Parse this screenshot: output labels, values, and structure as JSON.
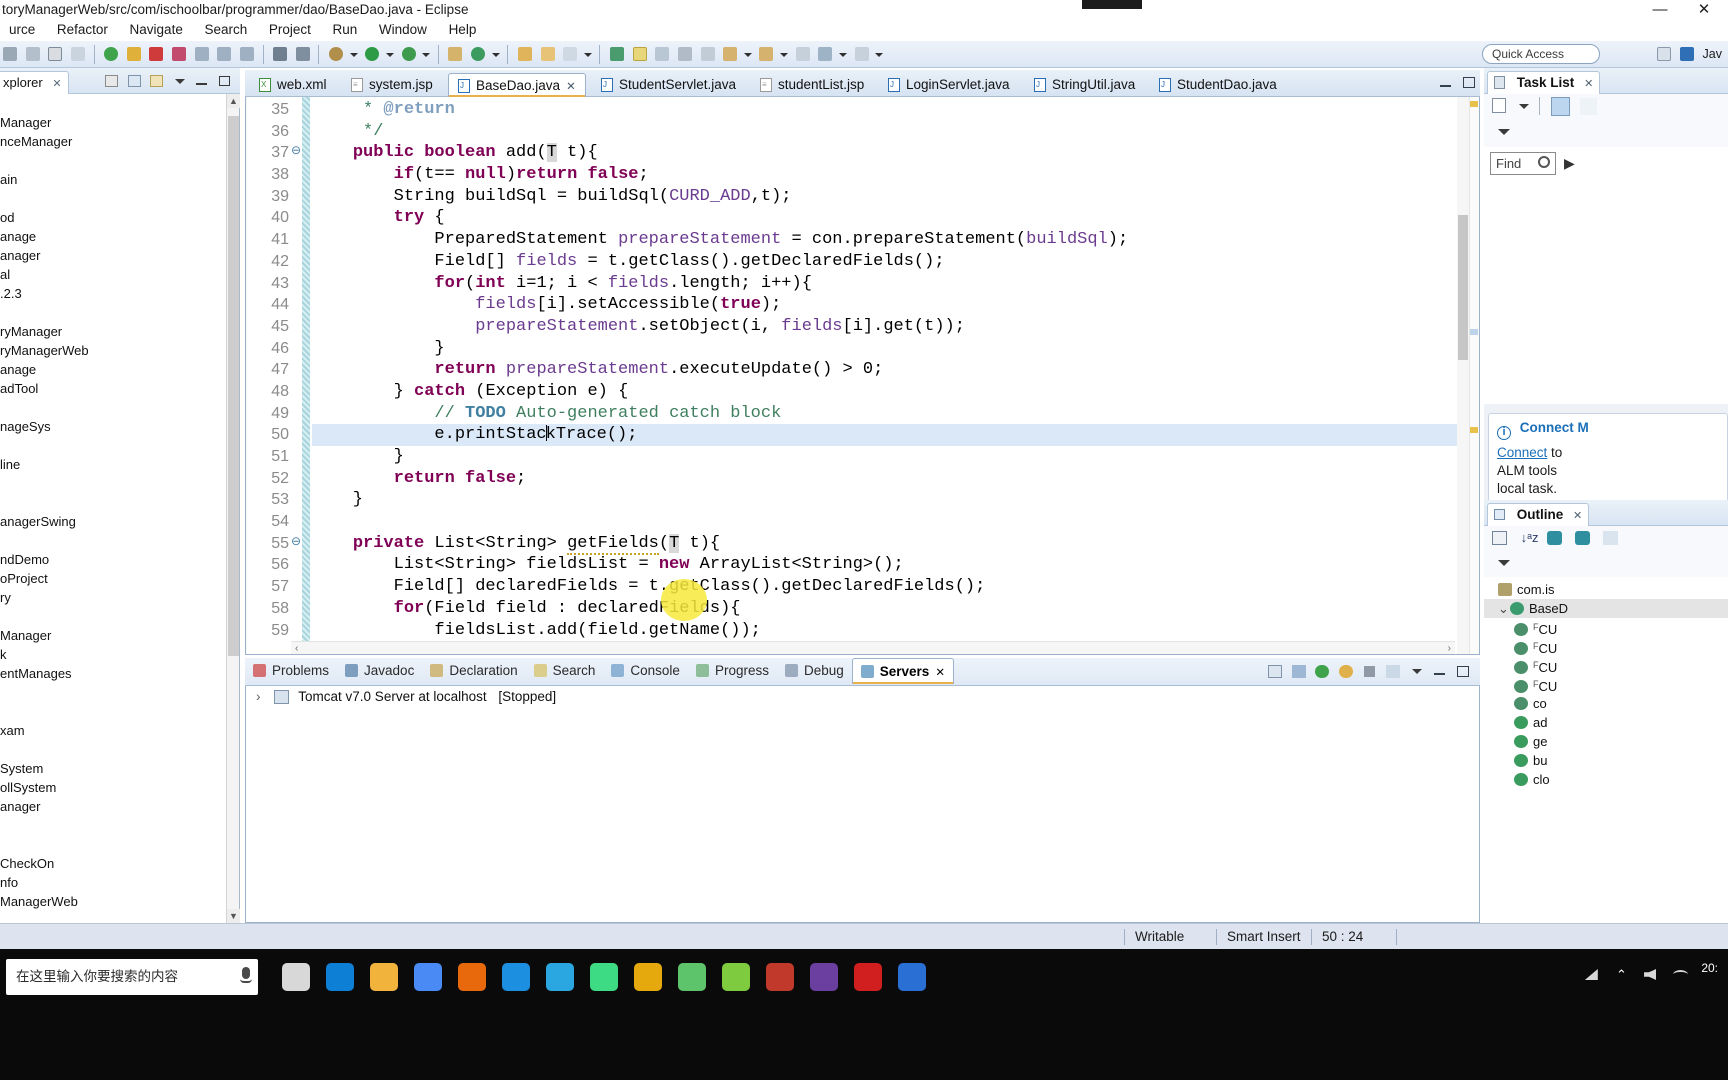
{
  "window": {
    "title": "toryManagerWeb/src/com/ischoolbar/programmer/dao/BaseDao.java - Eclipse",
    "minimize_label": "—",
    "close_label": "✕"
  },
  "menubar": {
    "items": [
      "urce",
      "Refactor",
      "Navigate",
      "Search",
      "Project",
      "Run",
      "Window",
      "Help"
    ]
  },
  "toolbar": {
    "quick_access_placeholder": "Quick Access",
    "perspective_label": "Jav"
  },
  "explorer": {
    "tab_label": "xplorer",
    "close_label": "✕",
    "tree": [
      "",
      "Manager",
      "nceManager",
      "",
      "ain",
      "",
      "od",
      "anage",
      "anager",
      "al",
      ".2.3",
      "",
      "ryManager",
      "ryManagerWeb",
      "anage",
      "adTool",
      "",
      "nageSys",
      "",
      "line",
      "",
      "",
      "anagerSwing",
      "",
      "ndDemo",
      "oProject",
      "ry",
      "",
      "Manager",
      "k",
      "entManages",
      "",
      "",
      "xam",
      "",
      "System",
      "ollSystem",
      "anager",
      "",
      "",
      "CheckOn",
      "nfo",
      "ManagerWeb"
    ]
  },
  "editor": {
    "tabs": [
      {
        "label": "web.xml",
        "icon": "xml-file-icon",
        "active": false,
        "icon_color": "#3b8f3b"
      },
      {
        "label": "system.jsp",
        "icon": "jsp-file-icon",
        "active": false,
        "icon_color": "#9a9a9a"
      },
      {
        "label": "BaseDao.java",
        "icon": "java-file-icon",
        "active": true,
        "icon_color": "#2a6fb5"
      },
      {
        "label": "StudentServlet.java",
        "icon": "java-file-icon",
        "active": false,
        "icon_color": "#2a6fb5"
      },
      {
        "label": "studentList.jsp",
        "icon": "jsp-file-icon",
        "active": false,
        "icon_color": "#9a9a9a"
      },
      {
        "label": "LoginServlet.java",
        "icon": "java-file-icon",
        "active": false,
        "icon_color": "#2a6fb5"
      },
      {
        "label": "StringUtil.java",
        "icon": "java-file-icon",
        "active": false,
        "icon_color": "#2a6fb5"
      },
      {
        "label": "StudentDao.java",
        "icon": "java-file-icon",
        "active": false,
        "icon_color": "#2a6fb5"
      }
    ],
    "active_tab_close": "✕",
    "lines": [
      {
        "no": "35",
        "fold": "",
        "marker": "",
        "html": "     <span class='cm'>* </span><span class='tag'>@return</span>"
      },
      {
        "no": "36",
        "fold": "",
        "marker": "",
        "html": "     <span class='cm'>*/</span>"
      },
      {
        "no": "37",
        "fold": "⊖",
        "marker": "",
        "html": "    <span class='kw'>public boolean</span> add(<span class='tparam'>T</span> t){"
      },
      {
        "no": "38",
        "fold": "",
        "marker": "",
        "html": "        <span class='kw'>if</span>(t== <span class='kw'>null</span>)<span class='kw'>return false</span>;"
      },
      {
        "no": "39",
        "fold": "",
        "marker": "",
        "html": "        String buildSql = buildSql(<span class='cst'>CURD_ADD</span>,t);"
      },
      {
        "no": "40",
        "fold": "",
        "marker": "",
        "html": "        <span class='kw'>try</span> {"
      },
      {
        "no": "41",
        "fold": "",
        "marker": "",
        "html": "            PreparedStatement <span class='cst'>prepareStatement</span> = con.prepareStatement(<span class='cst'>buildSql</span>);"
      },
      {
        "no": "42",
        "fold": "",
        "marker": "",
        "html": "            Field[] <span class='cst'>fields</span> = t.getClass().getDeclaredFields();"
      },
      {
        "no": "43",
        "fold": "",
        "marker": "",
        "html": "            <span class='kw'>for</span>(<span class='kw'>int</span> i=1; i &lt; <span class='cst'>fields</span>.length; i++){"
      },
      {
        "no": "44",
        "fold": "",
        "marker": "",
        "html": "                <span class='cst'>fields</span>[i].setAccessible(<span class='kw'>true</span>);"
      },
      {
        "no": "45",
        "fold": "",
        "marker": "",
        "html": "                <span class='cst'>prepareStatement</span>.setObject(i, <span class='cst'>fields</span>[i].get(t));"
      },
      {
        "no": "46",
        "fold": "",
        "marker": "",
        "html": "            }"
      },
      {
        "no": "47",
        "fold": "",
        "marker": "",
        "html": "            <span class='kw'>return</span> <span class='cst'>prepareStatement</span>.executeUpdate() &gt; 0;"
      },
      {
        "no": "48",
        "fold": "",
        "marker": "",
        "html": "        } <span class='kw'>catch</span> (Exception e) {"
      },
      {
        "no": "49",
        "fold": "",
        "marker": "todo",
        "html": "            <span class='cm'>// </span><span class='todo'>TODO</span><span class='cm'> Auto-generated catch block</span>"
      },
      {
        "no": "50",
        "fold": "",
        "marker": "",
        "highlight": true,
        "html": "            e.printStac<span class='caret'></span>kTrace();"
      },
      {
        "no": "51",
        "fold": "",
        "marker": "",
        "html": "        }"
      },
      {
        "no": "52",
        "fold": "",
        "marker": "",
        "html": "        <span class='kw'>return false</span>;"
      },
      {
        "no": "53",
        "fold": "",
        "marker": "",
        "html": "    }"
      },
      {
        "no": "54",
        "fold": "",
        "marker": "",
        "html": ""
      },
      {
        "no": "55",
        "fold": "⊖",
        "marker": "warn",
        "html": "    <span class='kw'>private</span> List&lt;String&gt; <span class='warnu'>getFields</span>(<span class='tparam'>T</span> t){"
      },
      {
        "no": "56",
        "fold": "",
        "marker": "",
        "html": "        List&lt;String&gt; fieldsList = <span class='kw'>new</span> ArrayList&lt;String&gt;();"
      },
      {
        "no": "57",
        "fold": "",
        "marker": "",
        "html": "        Field[] declaredFields = t.getClass().getDeclaredFields();"
      },
      {
        "no": "58",
        "fold": "",
        "marker": "",
        "html": "        <span class='kw'>for</span>(Field field : declaredFields){"
      },
      {
        "no": "59",
        "fold": "",
        "marker": "",
        "html": "            fieldsList.add(field.getName());"
      }
    ]
  },
  "bottom_panel": {
    "tabs": [
      {
        "label": "Problems",
        "icon": "problems-icon",
        "active": false
      },
      {
        "label": "Javadoc",
        "icon": "javadoc-icon",
        "active": false
      },
      {
        "label": "Declaration",
        "icon": "declaration-icon",
        "active": false
      },
      {
        "label": "Search",
        "icon": "search-icon",
        "active": false
      },
      {
        "label": "Console",
        "icon": "console-icon",
        "active": false
      },
      {
        "label": "Progress",
        "icon": "progress-icon",
        "active": false
      },
      {
        "label": "Debug",
        "icon": "debug-icon",
        "active": false
      },
      {
        "label": "Servers",
        "icon": "servers-icon",
        "active": true
      }
    ],
    "active_tab_close": "✕",
    "server_row": {
      "expand_arrow": "›",
      "name": "Tomcat v7.0 Server at localhost",
      "status": "[Stopped]"
    }
  },
  "task_list": {
    "tab_label": "Task List",
    "close_label": "✕",
    "find_placeholder": "Find",
    "find_value": "Find"
  },
  "connect_panel": {
    "title": "Connect M",
    "link_text": "Connect",
    "line1_rest": " to",
    "line2": "ALM tools",
    "line3": "local task."
  },
  "outline": {
    "tab_label": "Outline",
    "close_label": "✕",
    "items": [
      {
        "label": "com.is",
        "icon": "package-icon",
        "selected": false,
        "indent": 14
      },
      {
        "label": "BaseD",
        "icon": "class-icon",
        "selected": true,
        "indent": 14,
        "expander": "⌄"
      },
      {
        "label": "CU",
        "icon": "field-icon",
        "selected": false,
        "indent": 30,
        "sup": "F"
      },
      {
        "label": "CU",
        "icon": "field-icon",
        "selected": false,
        "indent": 30,
        "sup": "F"
      },
      {
        "label": "CU",
        "icon": "field-icon",
        "selected": false,
        "indent": 30,
        "sup": "F"
      },
      {
        "label": "CU",
        "icon": "field-icon",
        "selected": false,
        "indent": 30,
        "sup": "F"
      },
      {
        "label": "co",
        "icon": "field-icon",
        "selected": false,
        "indent": 30,
        "sup": ""
      },
      {
        "label": "ad",
        "icon": "method-icon",
        "selected": false,
        "indent": 30,
        "sup": ""
      },
      {
        "label": "ge",
        "icon": "method-icon",
        "selected": false,
        "indent": 30,
        "sup": ""
      },
      {
        "label": "bu",
        "icon": "method-icon",
        "selected": false,
        "indent": 30,
        "sup": ""
      },
      {
        "label": "clo",
        "icon": "method-icon",
        "selected": false,
        "indent": 30,
        "sup": ""
      }
    ]
  },
  "statusbar": {
    "writable": "Writable",
    "insert_mode": "Smart Insert",
    "position": "50 : 24"
  },
  "taskbar": {
    "search_placeholder": "在这里输入你要搜索的内容",
    "apps": [
      {
        "name": "task-view-icon",
        "color": "#d8d8d8"
      },
      {
        "name": "edge-browser-icon",
        "color": "#0d7fd4"
      },
      {
        "name": "file-explorer-icon",
        "color": "#f2b33d"
      },
      {
        "name": "chrome-browser-icon",
        "color": "#4a8af4"
      },
      {
        "name": "firefox-browser-icon",
        "color": "#e8690b"
      },
      {
        "name": "uc-browser-icon",
        "color": "#1c8fe0"
      },
      {
        "name": "tim-messenger-icon",
        "color": "#2aa7e0"
      },
      {
        "name": "android-studio-icon",
        "color": "#3ddc84"
      },
      {
        "name": "sublime-text-icon",
        "color": "#e5a90d"
      },
      {
        "name": "mysql-workbench-icon",
        "color": "#5ec46b"
      },
      {
        "name": "navicat-icon",
        "color": "#7ecb3f"
      },
      {
        "name": "xmind-icon",
        "color": "#c0392b"
      },
      {
        "name": "eclipse-ide-icon",
        "color": "#6b3fa0"
      },
      {
        "name": "recorder-icon",
        "color": "#d11f1f"
      },
      {
        "name": "wps-office-icon",
        "color": "#2a6fd4"
      }
    ],
    "tray": {
      "clock_line1": "20:",
      "chevron": "⌃"
    }
  }
}
